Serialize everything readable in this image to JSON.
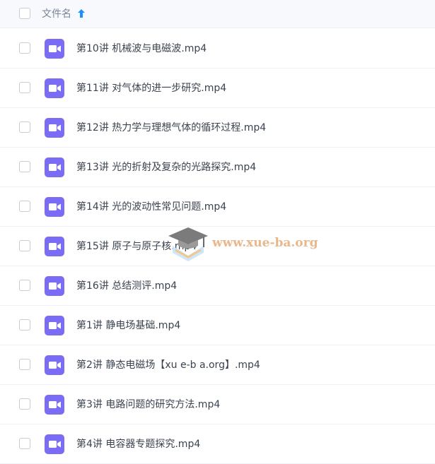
{
  "header": {
    "name_label": "文件名",
    "sort_direction": "ascending",
    "accent": "#1e8fff"
  },
  "files": [
    {
      "name": "第10讲 机械波与电磁波.mp4",
      "icon": "video-file-icon"
    },
    {
      "name": "第11讲 对气体的进一步研究.mp4",
      "icon": "video-file-icon"
    },
    {
      "name": "第12讲 热力学与理想气体的循环过程.mp4",
      "icon": "video-file-icon"
    },
    {
      "name": "第13讲 光的折射及复杂的光路探究.mp4",
      "icon": "video-file-icon"
    },
    {
      "name": "第14讲 光的波动性常见问题.mp4",
      "icon": "video-file-icon"
    },
    {
      "name": "第15讲 原子与原子核.mp4",
      "icon": "video-file-icon"
    },
    {
      "name": "第16讲 总结测评.mp4",
      "icon": "video-file-icon"
    },
    {
      "name": "第1讲 静电场基础.mp4",
      "icon": "video-file-icon"
    },
    {
      "name": "第2讲 静态电磁场【xu e-b a.org】.mp4",
      "icon": "video-file-icon"
    },
    {
      "name": "第3讲 电路问题的研究方法.mp4",
      "icon": "video-file-icon"
    },
    {
      "name": "第4讲 电容器专题探究.mp4",
      "icon": "video-file-icon"
    }
  ],
  "icon_color": "#7b6cf6",
  "watermark": {
    "text": "www.xue-ba.org"
  }
}
